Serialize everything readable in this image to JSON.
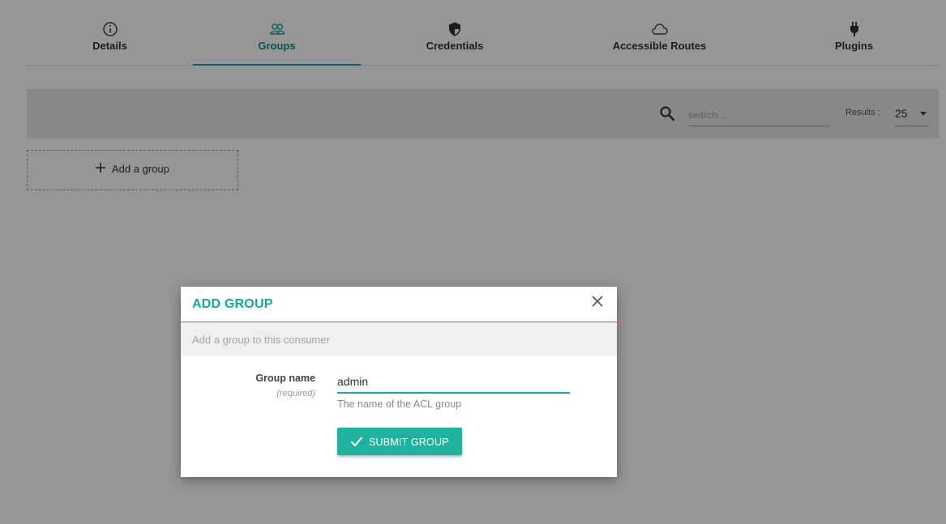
{
  "tabs": [
    {
      "label": "Details",
      "icon": "info-icon",
      "active": false
    },
    {
      "label": "Groups",
      "icon": "users-icon",
      "active": true
    },
    {
      "label": "Credentials",
      "icon": "shield-icon",
      "active": false
    },
    {
      "label": "Accessible Routes",
      "icon": "cloud-icon",
      "active": false
    },
    {
      "label": "Plugins",
      "icon": "plug-icon",
      "active": false
    }
  ],
  "toolbar": {
    "search_placeholder": "search...",
    "results_label": "Results :",
    "results_value": "25"
  },
  "add_group_card": {
    "label": "Add a group"
  },
  "modal": {
    "title": "ADD GROUP",
    "description": "Add a group to this consumer",
    "field_label": "Group name",
    "field_required": "(required)",
    "field_value": "admin",
    "field_help": "The name of the ACL group",
    "submit_label": "SUBMIT GROUP"
  },
  "colors": {
    "accent": "#14a897",
    "button": "#1fb39f",
    "overlay": "rgba(0,0,0,0.41)"
  }
}
